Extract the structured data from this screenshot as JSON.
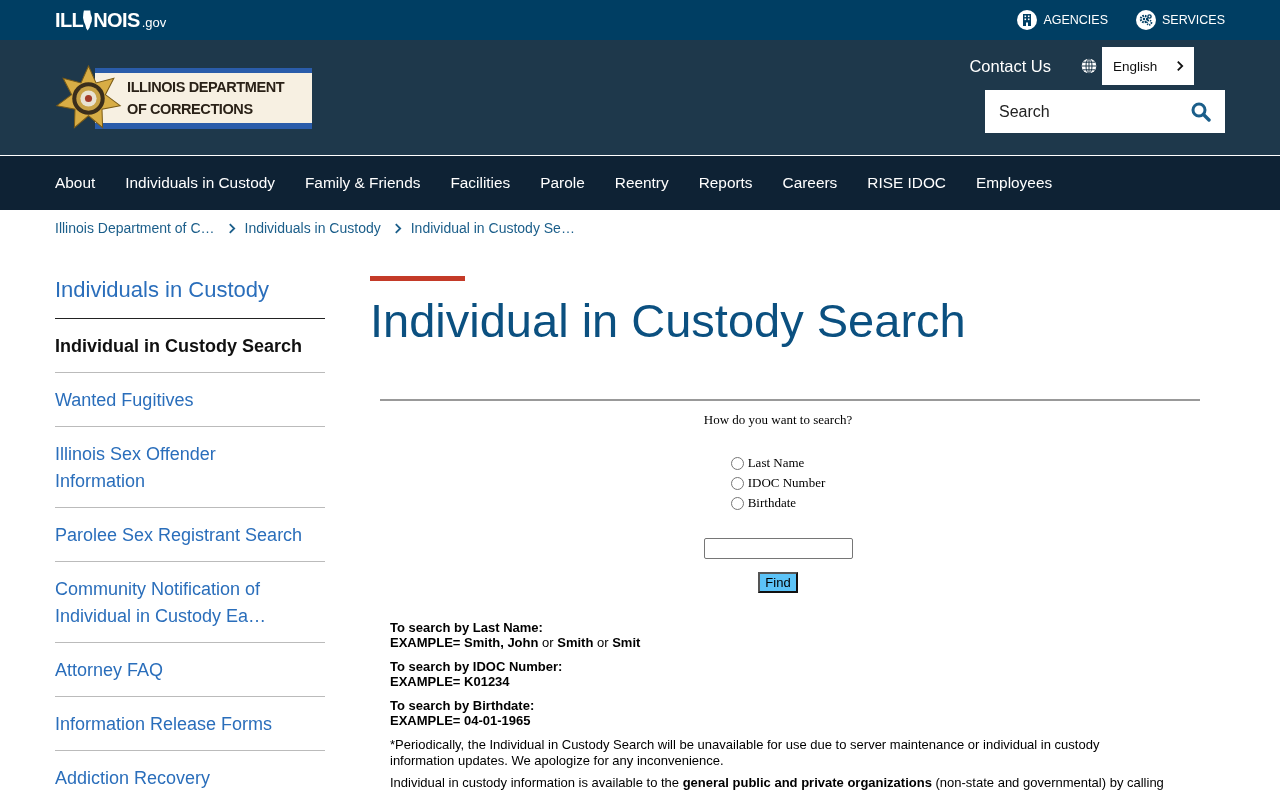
{
  "top_bar": {
    "logo": {
      "before": "ILL",
      "after": "NOIS",
      "suffix": ".gov"
    },
    "links": [
      "AGENCIES",
      "SERVICES"
    ]
  },
  "header": {
    "logo_lines": [
      "ILLINOIS DEPARTMENT",
      "OF CORRECTIONS"
    ],
    "contact": "Contact Us",
    "language": "English",
    "search": {
      "placeholder": "Search"
    }
  },
  "nav": [
    "About",
    "Individuals in Custody",
    "Family & Friends",
    "Facilities",
    "Parole",
    "Reentry",
    "Reports",
    "Careers",
    "RISE IDOC",
    "Employees"
  ],
  "breadcrumbs": [
    "Illinois Department of C…",
    "Individuals in Custody",
    "Individual in Custody Se…"
  ],
  "sidebar": {
    "title": "Individuals in Custody",
    "items": [
      {
        "label": "Individual in Custody Search",
        "selected": true
      },
      {
        "label": "Wanted Fugitives",
        "selected": false
      },
      {
        "label": "Illinois Sex Offender Information",
        "selected": false
      },
      {
        "label": "Parolee Sex Registrant Search",
        "selected": false
      },
      {
        "label": "Community Notification of Individual in Custody Ea…",
        "selected": false
      },
      {
        "label": "Attorney FAQ",
        "selected": false
      },
      {
        "label": "Information Release Forms",
        "selected": false
      },
      {
        "label": "Addiction Recovery",
        "selected": false
      }
    ]
  },
  "page": {
    "title": "Individual in Custody Search"
  },
  "search_form": {
    "prompt": "How do you want to search?",
    "options": [
      {
        "label": "Last Name",
        "selected": false
      },
      {
        "label": "IDOC Number",
        "selected": false
      },
      {
        "label": "Birthdate",
        "selected": false
      }
    ],
    "button": "Find"
  },
  "help": [
    {
      "heading": "To search by Last Name:",
      "example": "**EXAMPLE= Smith, John** or **Smith** or **Smit**"
    },
    {
      "heading": "To search by IDOC Number:",
      "example": "**EXAMPLE= K01234**"
    },
    {
      "heading": "To search by Birthdate:",
      "example": "**EXAMPLE= 04-01-1965**"
    }
  ],
  "notes": [
    "*Periodically, the Individual in Custody Search will be unavailable for use due to server maintenance or individual in custody information updates. We apologize for any inconvenience.",
    "Individual in custody information is available to the **general public and private organizations** (non-state and governmental) by calling"
  ]
}
